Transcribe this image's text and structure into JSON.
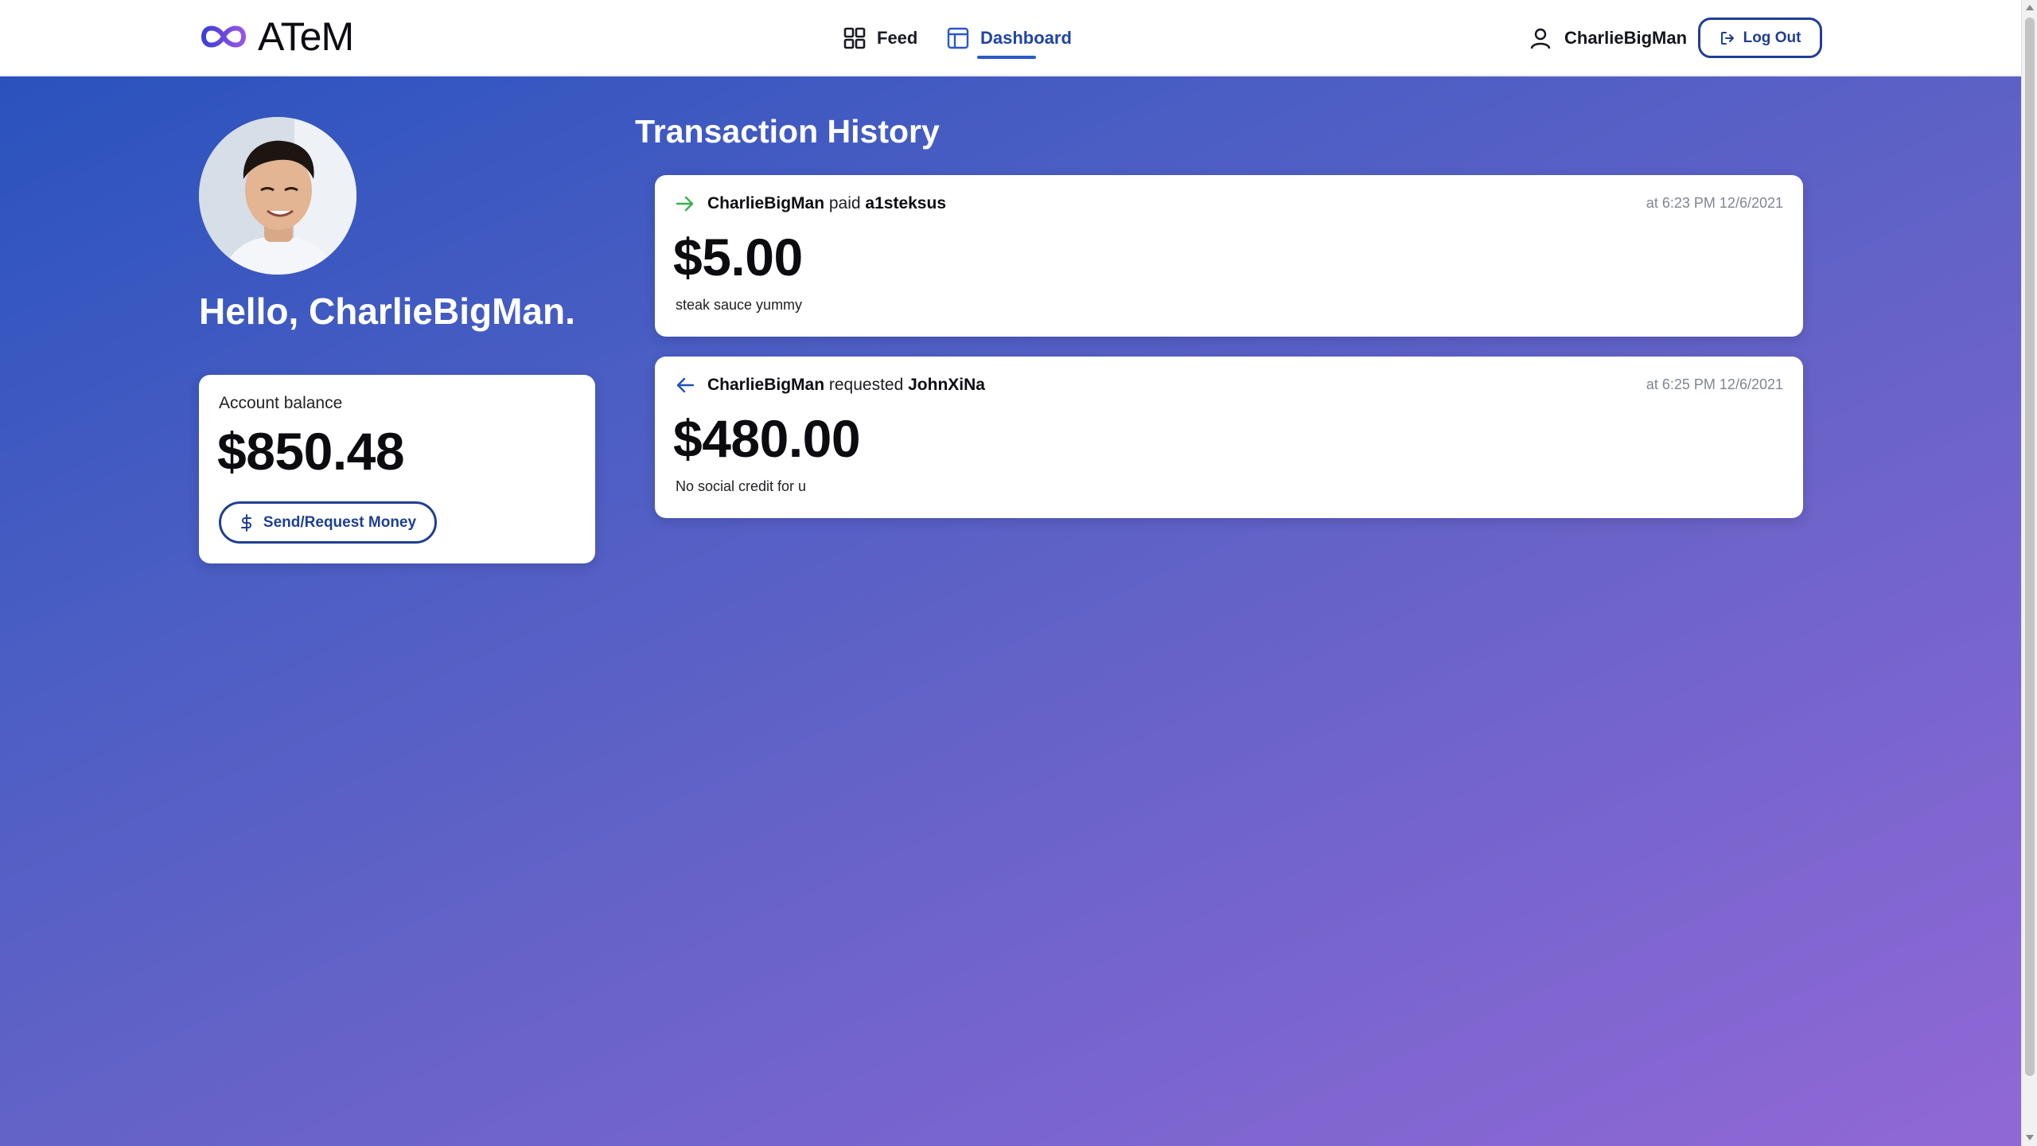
{
  "app": {
    "logo_text": "ATeM",
    "logo_icon": "infinity-icon"
  },
  "nav": {
    "feed_label": "Feed",
    "dashboard_label": "Dashboard",
    "active_tab": "Dashboard"
  },
  "user": {
    "username": "CharlieBigMan",
    "logout_label": "Log Out"
  },
  "profile": {
    "greeting": "Hello, CharlieBigMan."
  },
  "balance": {
    "label": "Account balance",
    "value": "$850.48",
    "send_request_label": "Send/Request Money"
  },
  "history": {
    "title": "Transaction History",
    "transactions": [
      {
        "from": "CharlieBigMan",
        "action": "paid",
        "to": "a1steksus",
        "time": "at 6:23 PM 12/6/2021",
        "amount": "$5.00",
        "note": "steak sauce yummy",
        "direction_icon": "arrow-right-icon",
        "direction_color": "#3bb04a"
      },
      {
        "from": "CharlieBigMan",
        "action": "requested",
        "to": "JohnXiNa",
        "time": "at 6:25 PM 12/6/2021",
        "amount": "$480.00",
        "note": "No social credit for u",
        "direction_icon": "arrow-left-icon",
        "direction_color": "#2350b8"
      }
    ]
  },
  "colors": {
    "accent": "#1e3f93",
    "gradient_start": "#2a52bd",
    "gradient_end": "#9168d6"
  }
}
